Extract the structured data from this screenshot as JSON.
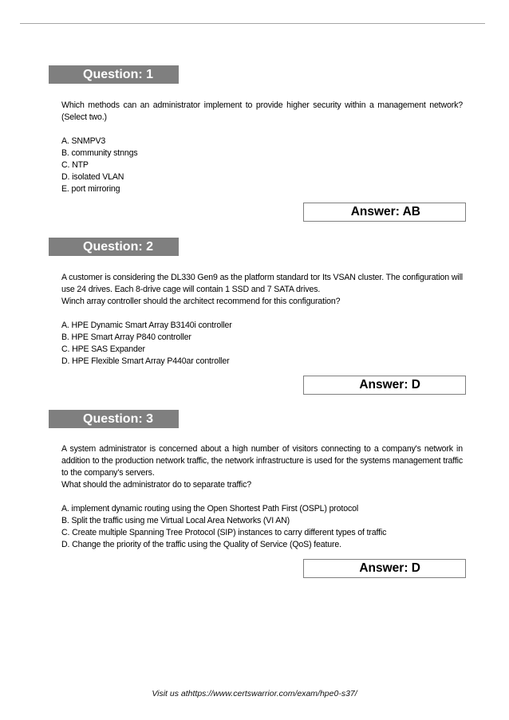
{
  "page": {
    "footer": "Visit us athttps://www.certswarrior.com/exam/hpe0-s37/"
  },
  "questions": [
    {
      "header": "Question: 1",
      "paragraphs": [
        "Which methods can an administrator implement to provide higher security within a management network? (Select two.)"
      ],
      "options": [
        "A. SNMPV3",
        "B. community stnngs",
        "C. NTP",
        "D. isolated VLAN",
        "E. port mirroring"
      ],
      "answer": "Answer: AB"
    },
    {
      "header": "Question: 2",
      "paragraphs": [
        "A customer is considering the DL330 Gen9 as the platform standard tor Its VSAN cluster. The configuration will use 24 drives.   Each 8-drive cage will contain 1 SSD and 7 SATA drives.",
        "Winch array controller should the architect recommend for this configuration?"
      ],
      "options": [
        "A. HPE Dynamic Smart Array B3140i controller",
        "B. HPE Smart Array P840 controller",
        "C. HPE SAS Expander",
        "D. HPE Flexible Smart Array P440ar controller"
      ],
      "answer": "Answer: D"
    },
    {
      "header": "Question: 3",
      "paragraphs": [
        "A system administrator is concerned about a high number of visitors connecting to a company's network in addition to the production network traffic, the network infrastructure is used for the systems management traffic to the company's servers.",
        "What should the administrator do to separate traffic?"
      ],
      "options": [
        "A. implement dynamic routing using the Open Shortest Path First (OSPL) protocol",
        "B. Split the traffic using me Virtual Local Area Networks (VI AN)",
        "C. Create multiple Spanning Tree Protocol (SIP) instances to carry different types of traffic",
        "D. Change the priority of the traffic using the Quality of Service (QoS) feature."
      ],
      "answer": "Answer: D"
    }
  ]
}
